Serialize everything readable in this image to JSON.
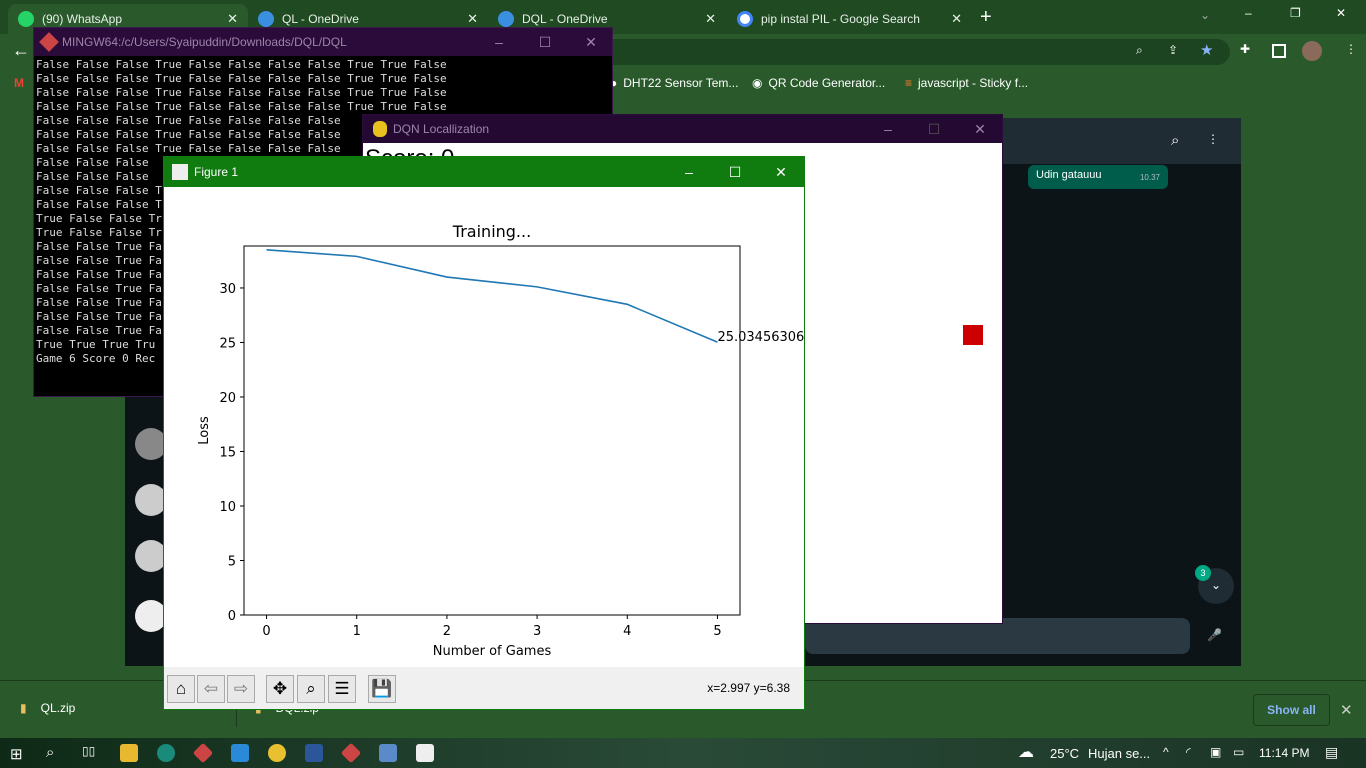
{
  "browser": {
    "tabs": [
      {
        "label": "(90) WhatsApp",
        "badge": "90",
        "active": true
      },
      {
        "label": "QL - OneDrive"
      },
      {
        "label": "DQL - OneDrive"
      },
      {
        "label": "pip instal PIL - Google Search"
      }
    ],
    "new_tab": "+",
    "bookmarks": [
      {
        "label": "DHT22 Sensor Tem..."
      },
      {
        "label": "QR Code Generator..."
      },
      {
        "label": "javascript - Sticky f..."
      }
    ]
  },
  "whatsapp": {
    "message": "Udin gatauuu",
    "message_time": "10.37",
    "unread_badge": "3"
  },
  "terminal": {
    "title": "MINGW64:/c/Users/Syaipuddin/Downloads/DQL/DQL",
    "lines": [
      "False False False True False False False False True True False",
      "False False False True False False False False True True False",
      "False False False True False False False False True True False",
      "False False False True False False False False True True False",
      "False False False True False False False False",
      "False False False True False False False False",
      "False False False True False False False False",
      "False False False",
      "False False False",
      "False False False T",
      "False False False T",
      "True False False Tr",
      "True False False Tr",
      "False False True Fa",
      "False False True Fa",
      "False False True Fa",
      "False False True Fa",
      "False False True Fa",
      "False False True Fa",
      "False False True Fa",
      "True True True Tru",
      "Game 6 Score 0 Rec"
    ]
  },
  "dqn": {
    "title": "DQN Locallization",
    "score": "Score: 0",
    "target_color": "#cc0000"
  },
  "figure": {
    "title": "Figure 1",
    "coords": "x=2.997 y=6.38"
  },
  "chart_data": {
    "type": "line",
    "title": "Training...",
    "xlabel": "Number of Games",
    "ylabel": "Loss",
    "x": [
      0,
      1,
      2,
      3,
      4,
      5
    ],
    "values": [
      33.5,
      32.9,
      31.0,
      30.1,
      28.5,
      25.03
    ],
    "xlim": [
      -0.25,
      5.25
    ],
    "ylim": [
      0,
      33.85
    ],
    "xticks": [
      "0",
      "1",
      "2",
      "3",
      "4",
      "5"
    ],
    "yticks": [
      "0",
      "5",
      "10",
      "15",
      "20",
      "25",
      "30"
    ],
    "annotation": "25.03456306",
    "line_color": "#1f77b4"
  },
  "downloads": {
    "items": [
      "QL.zip",
      "DQL.zip"
    ],
    "show_all": "Show all"
  },
  "taskbar": {
    "weather": "25°C",
    "weather_desc": "Hujan se...",
    "time": "11:14 PM"
  }
}
